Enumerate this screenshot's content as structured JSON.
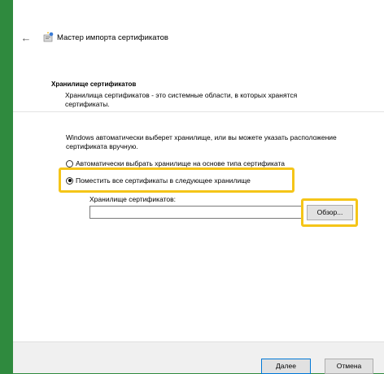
{
  "window": {
    "title": "Мастер импорта сертификатов",
    "back_icon": "arrow-left-icon"
  },
  "section": {
    "title": "Хранилище сертификатов",
    "description": "Хранилища сертификатов - это системные области, в которых хранятся сертификаты."
  },
  "intro": "Windows автоматически выберет хранилище, или вы можете указать расположение сертификата вручную.",
  "options": {
    "auto_label": "Автоматически выбрать хранилище на основе типа сертификата",
    "manual_label": "Поместить все сертификаты в следующее хранилище",
    "selected": "manual"
  },
  "store": {
    "label": "Хранилище сертификатов:",
    "value": "",
    "browse_label": "Обзор..."
  },
  "footer": {
    "next_label": "Далее",
    "cancel_label": "Отмена"
  },
  "colors": {
    "highlight": "#f5c518",
    "background": "#2f8a3e"
  }
}
